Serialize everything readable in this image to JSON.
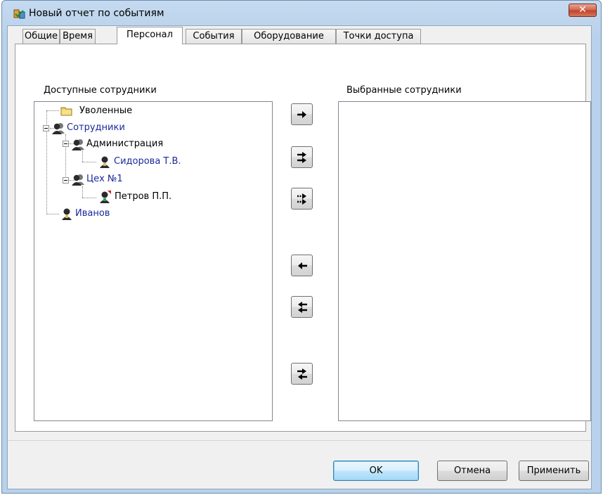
{
  "window": {
    "title": "Новый отчет по событиям",
    "close_label": "✕"
  },
  "tabs": [
    {
      "label": "Общие",
      "active": false
    },
    {
      "label": "Время",
      "active": false
    },
    {
      "label": "Персонал",
      "active": true
    },
    {
      "label": "События",
      "active": false
    },
    {
      "label": "Оборудование",
      "active": false
    },
    {
      "label": "Точки доступа",
      "active": false
    }
  ],
  "available": {
    "label": "Доступные сотрудники",
    "tree": [
      {
        "label": "Уволенные",
        "icon": "folder-icon",
        "color": "#000000"
      },
      {
        "label": "Сотрудники",
        "icon": "group-icon",
        "color": "#1a2a9e"
      },
      {
        "label": "Администрация",
        "icon": "group-icon",
        "color": "#000000"
      },
      {
        "label": "Сидорова Т.В.",
        "icon": "person-icon",
        "color": "#1a2a9e"
      },
      {
        "label": "Цех №1",
        "icon": "group-icon",
        "color": "#1a2a9e"
      },
      {
        "label": "Петров П.П.",
        "icon": "person-red-icon",
        "color": "#000000"
      },
      {
        "label": "Иванов",
        "icon": "person-icon",
        "color": "#1a2a9e"
      }
    ]
  },
  "selected": {
    "label": "Выбранные сотрудники",
    "items": []
  },
  "move_buttons": [
    {
      "name": "add-selected-button",
      "icon": "arrow-right-icon"
    },
    {
      "name": "add-all-button",
      "icon": "double-arrow-right-icon"
    },
    {
      "name": "add-group-button",
      "icon": "dotted-double-arrow-right-icon"
    },
    {
      "name": "remove-selected-button",
      "icon": "arrow-left-icon"
    },
    {
      "name": "remove-all-button",
      "icon": "double-arrow-left-icon"
    },
    {
      "name": "swap-button",
      "icon": "swap-arrows-icon"
    }
  ],
  "buttons": {
    "ok": "OK",
    "cancel": "Отмена",
    "apply": "Применить"
  }
}
